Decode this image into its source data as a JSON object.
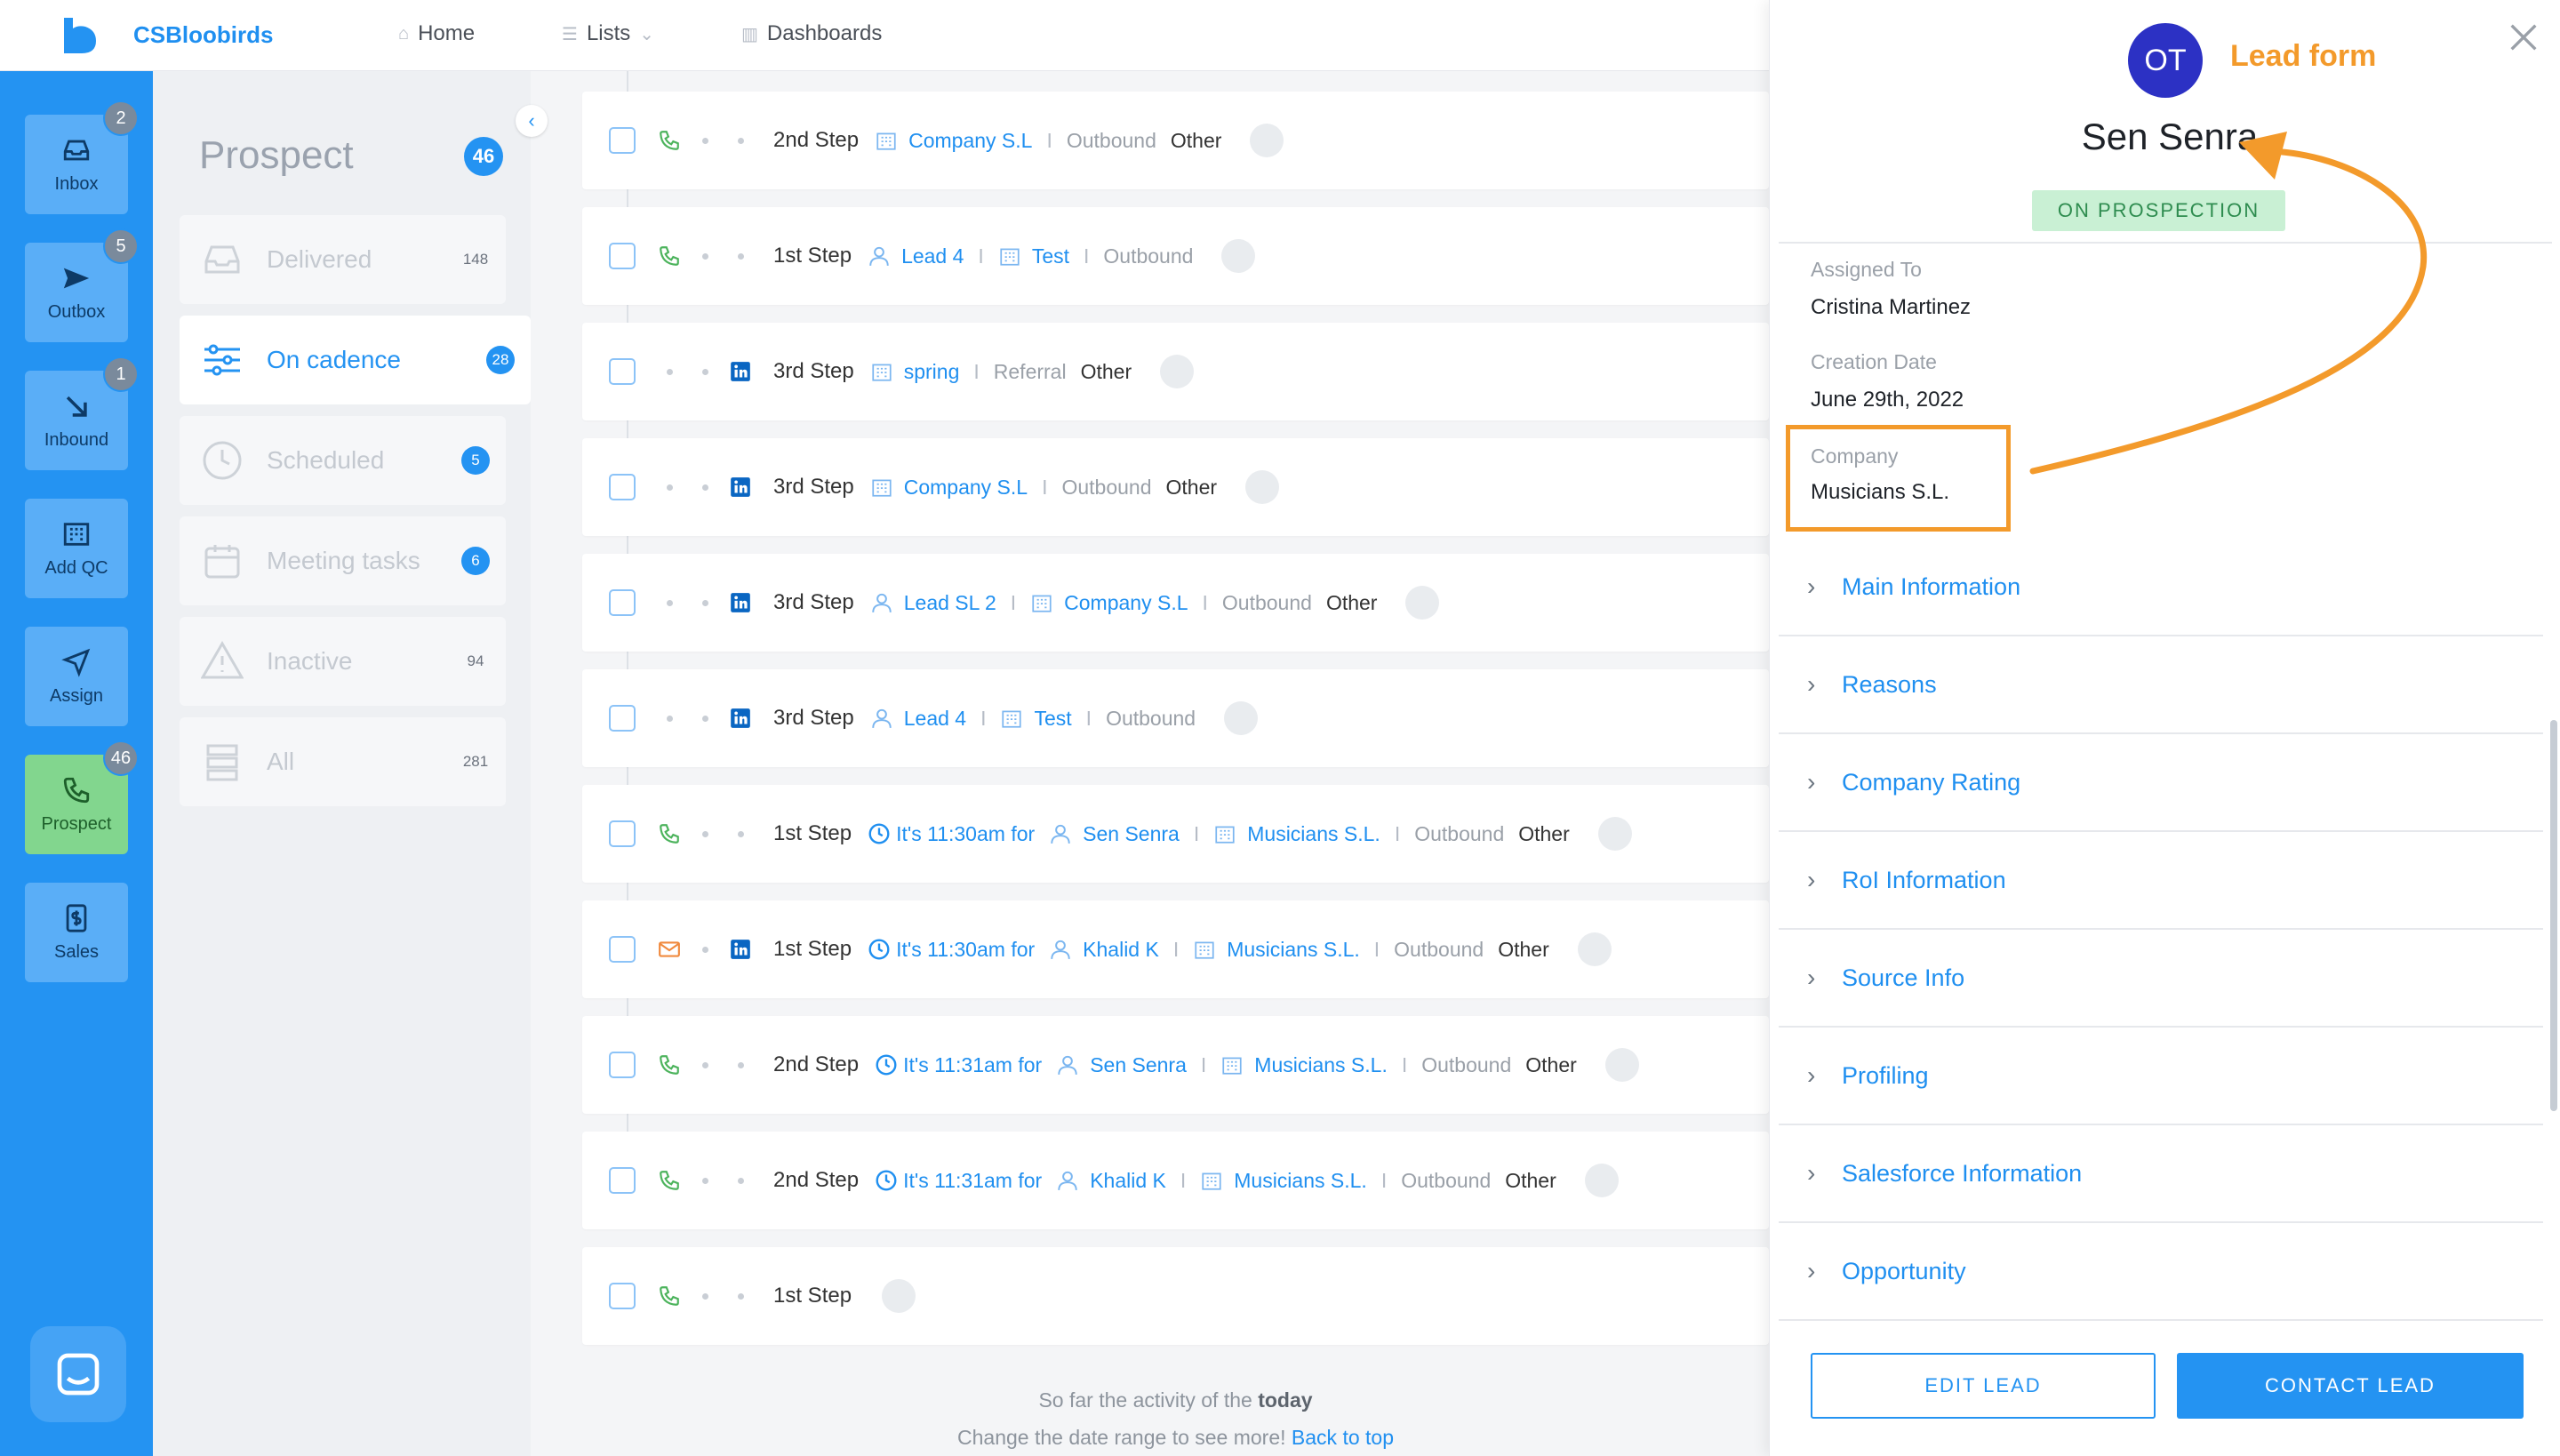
{
  "app": {
    "brand": "CSBloobirds"
  },
  "nav": {
    "home": "Home",
    "lists": "Lists",
    "dashboards": "Dashboards"
  },
  "rail": [
    {
      "label": "Inbox",
      "badge": "2"
    },
    {
      "label": "Outbox",
      "badge": "5"
    },
    {
      "label": "Inbound",
      "badge": "1"
    },
    {
      "label": "Add QC",
      "badge": ""
    },
    {
      "label": "Assign",
      "badge": ""
    },
    {
      "label": "Prospect",
      "badge": "46"
    },
    {
      "label": "Sales",
      "badge": ""
    }
  ],
  "subnav": {
    "title": "Prospect",
    "count": "46",
    "items": [
      {
        "label": "Delivered",
        "count": "148"
      },
      {
        "label": "On cadence",
        "count": "28"
      },
      {
        "label": "Scheduled",
        "count": "5"
      },
      {
        "label": "Meeting tasks",
        "count": "6"
      },
      {
        "label": "Inactive",
        "count": "94"
      },
      {
        "label": "All",
        "count": "281"
      }
    ]
  },
  "tasks": [
    {
      "step": "2nd Step",
      "company": "Company S.L",
      "source": "Outbound",
      "extra": "Other"
    },
    {
      "step": "1st Step",
      "lead": "Lead 4",
      "company": "Test",
      "source": "Outbound"
    },
    {
      "step": "3rd Step",
      "company": "spring",
      "source": "Referral",
      "extra": "Other"
    },
    {
      "step": "3rd Step",
      "company": "Company S.L",
      "source": "Outbound",
      "extra": "Other"
    },
    {
      "step": "3rd Step",
      "lead": "Lead SL 2",
      "company": "Company S.L",
      "source": "Outbound",
      "extra": "Other"
    },
    {
      "step": "3rd Step",
      "lead": "Lead 4",
      "company": "Test",
      "source": "Outbound"
    },
    {
      "step": "1st Step",
      "time": "It's 11:30am for",
      "lead": "Sen Senra",
      "company": "Musicians S.L.",
      "source": "Outbound",
      "extra": "Other"
    },
    {
      "step": "1st Step",
      "time": "It's 11:30am for",
      "lead": "Khalid K",
      "company": "Musicians S.L.",
      "source": "Outbound",
      "extra": "Other"
    },
    {
      "step": "2nd Step",
      "time": "It's 11:31am for",
      "lead": "Sen Senra",
      "company": "Musicians S.L.",
      "source": "Outbound",
      "extra": "Other"
    },
    {
      "step": "2nd Step",
      "time": "It's 11:31am for",
      "lead": "Khalid K",
      "company": "Musicians S.L.",
      "source": "Outbound",
      "extra": "Other"
    },
    {
      "step": "1st Step"
    }
  ],
  "footer": {
    "line1_prefix": "So far the activity of the",
    "line1_bold": "today",
    "line2_prefix": "Change the date range to see more!",
    "line2_link": "Back to top"
  },
  "lead": {
    "initials": "OT",
    "form_label": "Lead form",
    "name": "Sen Senra",
    "status": "ON PROSPECTION",
    "assigned_label": "Assigned To",
    "assigned_value": "Cristina Martinez",
    "creation_label": "Creation Date",
    "creation_value": "June 29th, 2022",
    "company_label": "Company",
    "company_value": "Musicians S.L.",
    "sections": [
      "Main Information",
      "Reasons",
      "Company Rating",
      "RoI Information",
      "Source Info",
      "Profiling",
      "Salesforce Information",
      "Opportunity"
    ],
    "edit_label": "EDIT LEAD",
    "contact_label": "CONTACT LEAD"
  },
  "colors": {
    "accent": "#2493f2",
    "highlight": "#f39a2b",
    "status_bg": "#c9f0d4"
  }
}
